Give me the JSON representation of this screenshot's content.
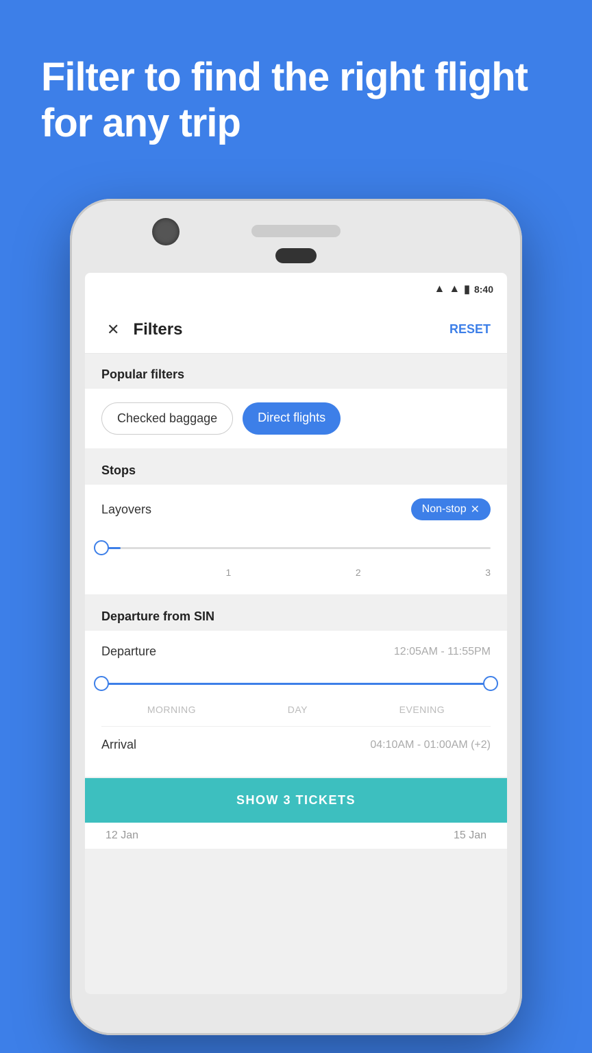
{
  "headline": "Filter to find the right flight for any trip",
  "status_bar": {
    "time": "8:40"
  },
  "header": {
    "title": "Filters",
    "reset_label": "RESET"
  },
  "popular_filters": {
    "section_label": "Popular filters",
    "chips": [
      {
        "label": "Checked baggage",
        "active": false
      },
      {
        "label": "Direct flights",
        "active": true
      }
    ]
  },
  "stops": {
    "section_label": "Stops",
    "layovers_label": "Layovers",
    "nonstop_label": "Non-stop",
    "slider_ticks": [
      "",
      "1",
      "2",
      "3"
    ]
  },
  "departure": {
    "section_label": "Departure from SIN",
    "departure_label": "Departure",
    "departure_time_range": "12:05AM - 11:55PM",
    "periods": [
      "MORNING",
      "DAY",
      "EVENING"
    ],
    "arrival_label": "Arrival",
    "arrival_time_range": "04:10AM - 01:00AM (+2)"
  },
  "show_button": {
    "label": "SHOW 3 TICKETS"
  },
  "dates": {
    "left": "12 Jan",
    "right": "15 Jan"
  }
}
